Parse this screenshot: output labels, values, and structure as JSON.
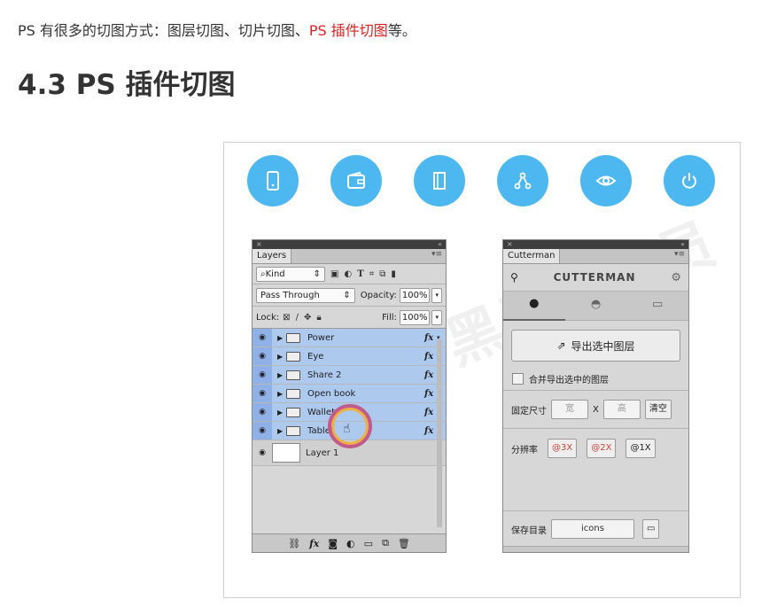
{
  "intro": {
    "prefix": "PS 有很多的切图方式：图层切图、切片切图、",
    "highlight": "PS 插件切图",
    "suffix": "等。"
  },
  "heading": "4.3 PS 插件切图",
  "colors": {
    "circle": "#4db8f0",
    "highlight": "#e02020"
  },
  "icon_circles": [
    "tablet-icon",
    "wallet-icon",
    "book-icon",
    "share-icon",
    "eye-icon",
    "power-icon"
  ],
  "layers_panel": {
    "tab": "Layers",
    "kind_label": "Kind",
    "blend_mode": "Pass Through",
    "opacity_label": "Opacity:",
    "opacity_value": "100%",
    "lock_label": "Lock:",
    "fill_label": "Fill:",
    "fill_value": "100%",
    "layers": [
      {
        "name": "Power",
        "fx": "fx"
      },
      {
        "name": "Eye",
        "fx": "fx"
      },
      {
        "name": "Share 2",
        "fx": "fx"
      },
      {
        "name": "Open book",
        "fx": "fx"
      },
      {
        "name": "Wallet",
        "fx": "fx"
      },
      {
        "name": "Tablet",
        "fx": "fx"
      }
    ],
    "base_layer": "Layer 1",
    "footer_fx": "fx"
  },
  "cutterman": {
    "tab": "Cutterman",
    "brand": "CUTTERMAN",
    "export_button": "导出选中图层",
    "merge_label": "合并导出选中的图层",
    "fixed_size_label": "固定尺寸",
    "width_placeholder": "宽",
    "x_label": "X",
    "height_placeholder": "高",
    "clear_button": "清空",
    "resolution_label": "分辨率",
    "res_options": [
      "@3X",
      "@2X",
      "@1X"
    ],
    "save_dir_label": "保存目录",
    "save_dir_value": "icons"
  }
}
